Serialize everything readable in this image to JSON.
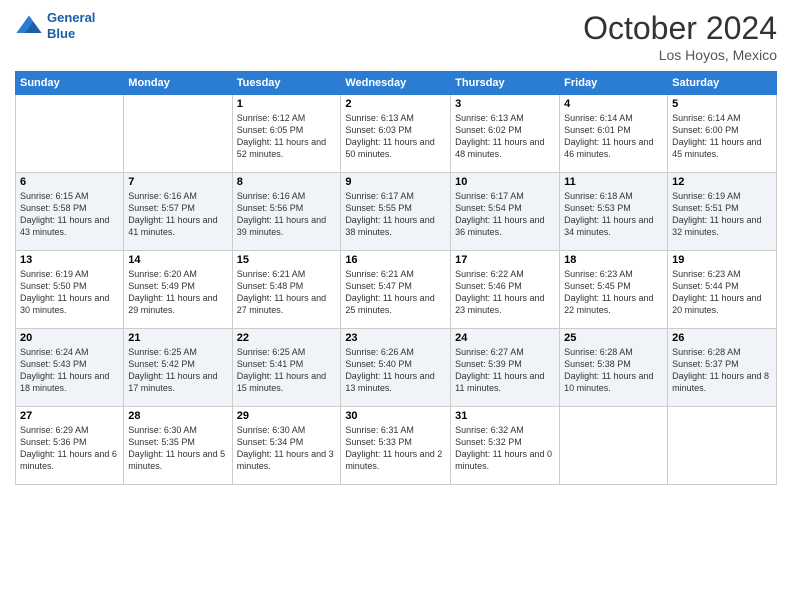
{
  "header": {
    "logo_line1": "General",
    "logo_line2": "Blue",
    "month": "October 2024",
    "location": "Los Hoyos, Mexico"
  },
  "weekdays": [
    "Sunday",
    "Monday",
    "Tuesday",
    "Wednesday",
    "Thursday",
    "Friday",
    "Saturday"
  ],
  "weeks": [
    [
      {
        "day": "",
        "info": ""
      },
      {
        "day": "",
        "info": ""
      },
      {
        "day": "1",
        "info": "Sunrise: 6:12 AM\nSunset: 6:05 PM\nDaylight: 11 hours and 52 minutes."
      },
      {
        "day": "2",
        "info": "Sunrise: 6:13 AM\nSunset: 6:03 PM\nDaylight: 11 hours and 50 minutes."
      },
      {
        "day": "3",
        "info": "Sunrise: 6:13 AM\nSunset: 6:02 PM\nDaylight: 11 hours and 48 minutes."
      },
      {
        "day": "4",
        "info": "Sunrise: 6:14 AM\nSunset: 6:01 PM\nDaylight: 11 hours and 46 minutes."
      },
      {
        "day": "5",
        "info": "Sunrise: 6:14 AM\nSunset: 6:00 PM\nDaylight: 11 hours and 45 minutes."
      }
    ],
    [
      {
        "day": "6",
        "info": "Sunrise: 6:15 AM\nSunset: 5:58 PM\nDaylight: 11 hours and 43 minutes."
      },
      {
        "day": "7",
        "info": "Sunrise: 6:16 AM\nSunset: 5:57 PM\nDaylight: 11 hours and 41 minutes."
      },
      {
        "day": "8",
        "info": "Sunrise: 6:16 AM\nSunset: 5:56 PM\nDaylight: 11 hours and 39 minutes."
      },
      {
        "day": "9",
        "info": "Sunrise: 6:17 AM\nSunset: 5:55 PM\nDaylight: 11 hours and 38 minutes."
      },
      {
        "day": "10",
        "info": "Sunrise: 6:17 AM\nSunset: 5:54 PM\nDaylight: 11 hours and 36 minutes."
      },
      {
        "day": "11",
        "info": "Sunrise: 6:18 AM\nSunset: 5:53 PM\nDaylight: 11 hours and 34 minutes."
      },
      {
        "day": "12",
        "info": "Sunrise: 6:19 AM\nSunset: 5:51 PM\nDaylight: 11 hours and 32 minutes."
      }
    ],
    [
      {
        "day": "13",
        "info": "Sunrise: 6:19 AM\nSunset: 5:50 PM\nDaylight: 11 hours and 30 minutes."
      },
      {
        "day": "14",
        "info": "Sunrise: 6:20 AM\nSunset: 5:49 PM\nDaylight: 11 hours and 29 minutes."
      },
      {
        "day": "15",
        "info": "Sunrise: 6:21 AM\nSunset: 5:48 PM\nDaylight: 11 hours and 27 minutes."
      },
      {
        "day": "16",
        "info": "Sunrise: 6:21 AM\nSunset: 5:47 PM\nDaylight: 11 hours and 25 minutes."
      },
      {
        "day": "17",
        "info": "Sunrise: 6:22 AM\nSunset: 5:46 PM\nDaylight: 11 hours and 23 minutes."
      },
      {
        "day": "18",
        "info": "Sunrise: 6:23 AM\nSunset: 5:45 PM\nDaylight: 11 hours and 22 minutes."
      },
      {
        "day": "19",
        "info": "Sunrise: 6:23 AM\nSunset: 5:44 PM\nDaylight: 11 hours and 20 minutes."
      }
    ],
    [
      {
        "day": "20",
        "info": "Sunrise: 6:24 AM\nSunset: 5:43 PM\nDaylight: 11 hours and 18 minutes."
      },
      {
        "day": "21",
        "info": "Sunrise: 6:25 AM\nSunset: 5:42 PM\nDaylight: 11 hours and 17 minutes."
      },
      {
        "day": "22",
        "info": "Sunrise: 6:25 AM\nSunset: 5:41 PM\nDaylight: 11 hours and 15 minutes."
      },
      {
        "day": "23",
        "info": "Sunrise: 6:26 AM\nSunset: 5:40 PM\nDaylight: 11 hours and 13 minutes."
      },
      {
        "day": "24",
        "info": "Sunrise: 6:27 AM\nSunset: 5:39 PM\nDaylight: 11 hours and 11 minutes."
      },
      {
        "day": "25",
        "info": "Sunrise: 6:28 AM\nSunset: 5:38 PM\nDaylight: 11 hours and 10 minutes."
      },
      {
        "day": "26",
        "info": "Sunrise: 6:28 AM\nSunset: 5:37 PM\nDaylight: 11 hours and 8 minutes."
      }
    ],
    [
      {
        "day": "27",
        "info": "Sunrise: 6:29 AM\nSunset: 5:36 PM\nDaylight: 11 hours and 6 minutes."
      },
      {
        "day": "28",
        "info": "Sunrise: 6:30 AM\nSunset: 5:35 PM\nDaylight: 11 hours and 5 minutes."
      },
      {
        "day": "29",
        "info": "Sunrise: 6:30 AM\nSunset: 5:34 PM\nDaylight: 11 hours and 3 minutes."
      },
      {
        "day": "30",
        "info": "Sunrise: 6:31 AM\nSunset: 5:33 PM\nDaylight: 11 hours and 2 minutes."
      },
      {
        "day": "31",
        "info": "Sunrise: 6:32 AM\nSunset: 5:32 PM\nDaylight: 11 hours and 0 minutes."
      },
      {
        "day": "",
        "info": ""
      },
      {
        "day": "",
        "info": ""
      }
    ]
  ]
}
